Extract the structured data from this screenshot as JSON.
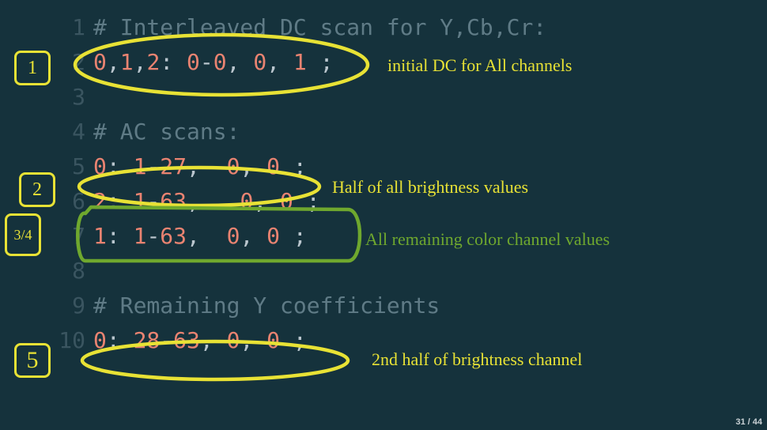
{
  "slide": {
    "page": "31 / 44"
  },
  "code": {
    "lines": [
      {
        "n": "1",
        "segs": [
          {
            "cls": "cmt",
            "t": "# Interleaved DC scan for Y,Cb,Cr:"
          }
        ]
      },
      {
        "n": "2",
        "segs": [
          {
            "cls": "num",
            "t": "0"
          },
          {
            "cls": "punc",
            "t": ","
          },
          {
            "cls": "num",
            "t": "1"
          },
          {
            "cls": "punc",
            "t": ","
          },
          {
            "cls": "num",
            "t": "2"
          },
          {
            "cls": "punc",
            "t": ": "
          },
          {
            "cls": "num",
            "t": "0"
          },
          {
            "cls": "punc",
            "t": "-"
          },
          {
            "cls": "num",
            "t": "0"
          },
          {
            "cls": "punc",
            "t": ", "
          },
          {
            "cls": "num",
            "t": "0"
          },
          {
            "cls": "punc",
            "t": ", "
          },
          {
            "cls": "num",
            "t": "1 "
          },
          {
            "cls": "punc",
            "t": ";"
          }
        ]
      },
      {
        "n": "3",
        "segs": []
      },
      {
        "n": "4",
        "segs": [
          {
            "cls": "cmt",
            "t": "# AC scans:"
          }
        ]
      },
      {
        "n": "5",
        "segs": [
          {
            "cls": "num",
            "t": "0"
          },
          {
            "cls": "punc",
            "t": ": "
          },
          {
            "cls": "num",
            "t": "1"
          },
          {
            "cls": "punc",
            "t": "-"
          },
          {
            "cls": "num",
            "t": "27"
          },
          {
            "cls": "punc",
            "t": ",  "
          },
          {
            "cls": "num",
            "t": "0"
          },
          {
            "cls": "punc",
            "t": ", "
          },
          {
            "cls": "num",
            "t": "0 "
          },
          {
            "cls": "punc",
            "t": ";"
          }
        ]
      },
      {
        "n": "6",
        "segs": [
          {
            "cls": "num",
            "t": "2"
          },
          {
            "cls": "punc",
            "t": ": "
          },
          {
            "cls": "num",
            "t": "1"
          },
          {
            "cls": "punc",
            "t": "-"
          },
          {
            "cls": "num",
            "t": "63"
          },
          {
            "cls": "punc",
            "t": ",   "
          },
          {
            "cls": "num",
            "t": "0"
          },
          {
            "cls": "punc",
            "t": ", "
          },
          {
            "cls": "num",
            "t": "0 "
          },
          {
            "cls": "punc",
            "t": ";"
          }
        ]
      },
      {
        "n": "7",
        "segs": [
          {
            "cls": "num",
            "t": "1"
          },
          {
            "cls": "punc",
            "t": ": "
          },
          {
            "cls": "num",
            "t": "1"
          },
          {
            "cls": "punc",
            "t": "-"
          },
          {
            "cls": "num",
            "t": "63"
          },
          {
            "cls": "punc",
            "t": ",  "
          },
          {
            "cls": "num",
            "t": "0"
          },
          {
            "cls": "punc",
            "t": ", "
          },
          {
            "cls": "num",
            "t": "0 "
          },
          {
            "cls": "punc",
            "t": ";"
          }
        ]
      },
      {
        "n": "8",
        "segs": []
      },
      {
        "n": "9",
        "segs": [
          {
            "cls": "cmt",
            "t": "# Remaining Y coefficients"
          }
        ]
      },
      {
        "n": "10",
        "segs": [
          {
            "cls": "num",
            "t": "0"
          },
          {
            "cls": "punc",
            "t": ": "
          },
          {
            "cls": "num",
            "t": "28"
          },
          {
            "cls": "punc",
            "t": "-"
          },
          {
            "cls": "num",
            "t": "63"
          },
          {
            "cls": "punc",
            "t": ", "
          },
          {
            "cls": "num",
            "t": "0"
          },
          {
            "cls": "punc",
            "t": ", "
          },
          {
            "cls": "num",
            "t": "0 "
          },
          {
            "cls": "punc",
            "t": ";"
          }
        ]
      }
    ]
  },
  "annotations": {
    "a1": "initial DC for All channels",
    "a2": "Half of all brightness values",
    "a3": "All remaining color channel values",
    "a4": "2nd half of brightness channel"
  },
  "steps": {
    "s1": "1",
    "s2": "2",
    "s3": "3/4",
    "s5": "5"
  },
  "colors": {
    "yellow": "#e8e235",
    "green": "#6fa82e"
  }
}
